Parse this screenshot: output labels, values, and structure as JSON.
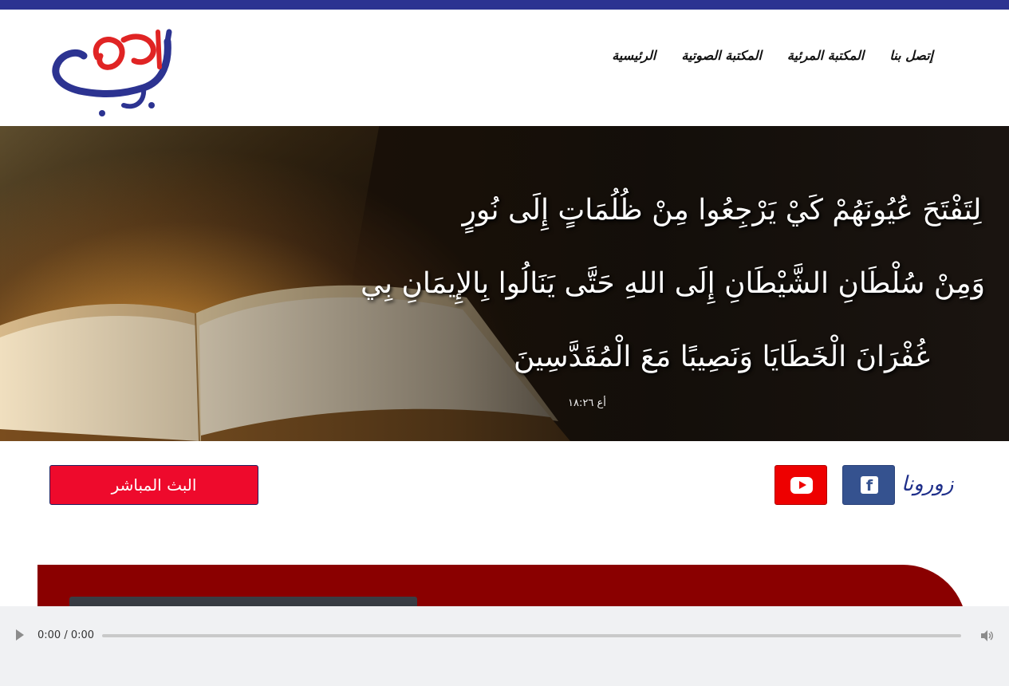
{
  "header": {
    "logo_text": "نجيب هاني",
    "nav": [
      {
        "label": "الرئيسية"
      },
      {
        "label": "المكتبة الصوتية"
      },
      {
        "label": "المكتبة المرئية"
      },
      {
        "label": "إتصل بنا"
      }
    ]
  },
  "hero": {
    "verse_lines": [
      "لِتَفْتَحَ عُيُونَهُمْ كَيْ يَرْجِعُوا مِنْ ظُلُمَاتٍ إِلَى نُورٍ",
      "وَمِنْ سُلْطَانِ الشَّيْطَانِ إِلَى اللهِ حَتَّى يَنَالُوا بِالإِيمَانِ بِي",
      "غُفْرَانَ الْخَطَايَا وَنَصِيبًا مَعَ الْمُقَدَّسِينَ"
    ],
    "verse_reference": "أع ١٨:٢٦"
  },
  "social": {
    "follow_label": "زورونا",
    "facebook_icon": "facebook-icon",
    "youtube_icon": "youtube-icon",
    "facebook_glyph": "f"
  },
  "live": {
    "label": "البث المباشر"
  },
  "audio_player": {
    "time": "0:00 / 0:00",
    "play_icon": "play-icon",
    "volume_icon": "volume-icon"
  },
  "colors": {
    "top_bar": "#2c3391",
    "facebook": "#35528f",
    "youtube": "#ee0000",
    "live_button": "#ee0a2c",
    "panel": "#8a0000",
    "logo_blue": "#2c3391",
    "logo_red": "#e02424"
  }
}
